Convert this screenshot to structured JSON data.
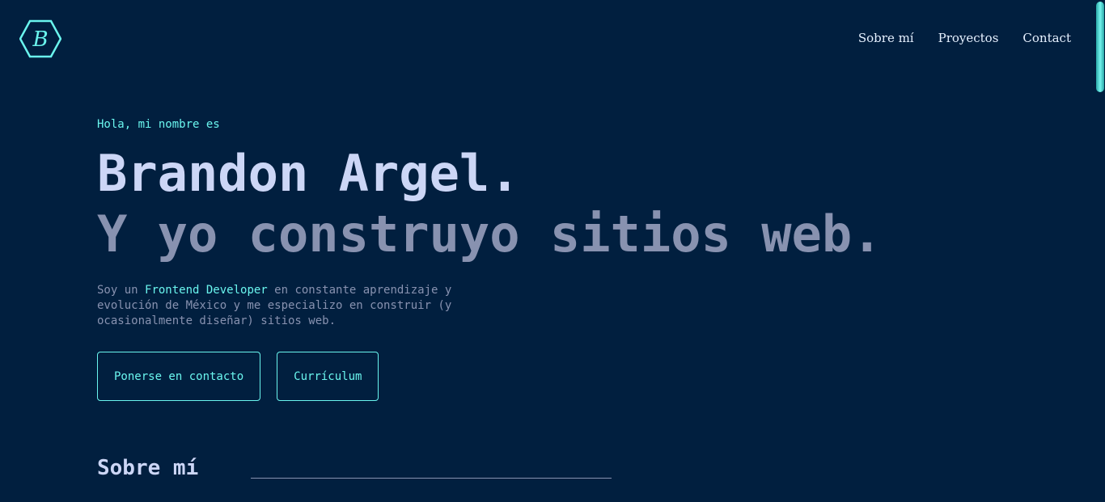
{
  "brand": {
    "logo_letter": "B",
    "icon": "hexagon-logo-icon",
    "accent_color": "#6af5ee"
  },
  "nav": {
    "items": [
      {
        "label": "Sobre mí"
      },
      {
        "label": "Proyectos"
      },
      {
        "label": "Contact"
      }
    ]
  },
  "hero": {
    "greeting": "Hola, mi nombre es",
    "name": "Brandon Argel.",
    "tagline": "Y yo construyo sitios web.",
    "bio_prefix": "Soy un ",
    "bio_highlight": "Frontend Developer",
    "bio_suffix": " en constante aprendizaje y evolución de México y me especializo en construir (y ocasionalmente diseñar) sitios web."
  },
  "buttons": {
    "contact_label": "Ponerse en contacto",
    "resume_label": "Currículum"
  },
  "about": {
    "title": "Sobre mí"
  },
  "colors": {
    "background": "#011f3f",
    "heading": "#ccd6f6",
    "muted": "#8892b0",
    "accent": "#6af5ee"
  }
}
